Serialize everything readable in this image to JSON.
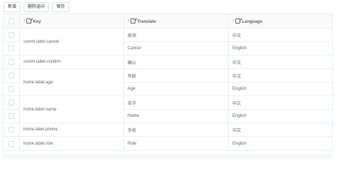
{
  "toolbar": {
    "add_label": "新增",
    "delete_label": "删除选中",
    "save_label": "保存"
  },
  "table": {
    "columns": {
      "key": "Key",
      "translate": "Translate",
      "language": "Language"
    },
    "groups": [
      {
        "key": "comm.label.cancel",
        "rows": [
          {
            "translate": "取消",
            "language": "中文"
          },
          {
            "translate": "Cancel",
            "language": "English"
          }
        ]
      },
      {
        "key": "comm.label.confirm",
        "rows": [
          {
            "translate": "确认",
            "language": "中文"
          }
        ]
      },
      {
        "key": "home.label.age",
        "rows": [
          {
            "translate": "年龄",
            "language": "中文"
          },
          {
            "translate": "Age",
            "language": "English"
          }
        ]
      },
      {
        "key": "home.label.name",
        "rows": [
          {
            "translate": "名字",
            "language": "中文"
          },
          {
            "translate": "Name",
            "language": "English"
          }
        ]
      },
      {
        "key": "home.label.phone",
        "rows": [
          {
            "translate": "手机",
            "language": "中文"
          }
        ]
      },
      {
        "key": "home.label.role",
        "rows": [
          {
            "translate": "Role",
            "language": "English"
          }
        ]
      }
    ]
  }
}
